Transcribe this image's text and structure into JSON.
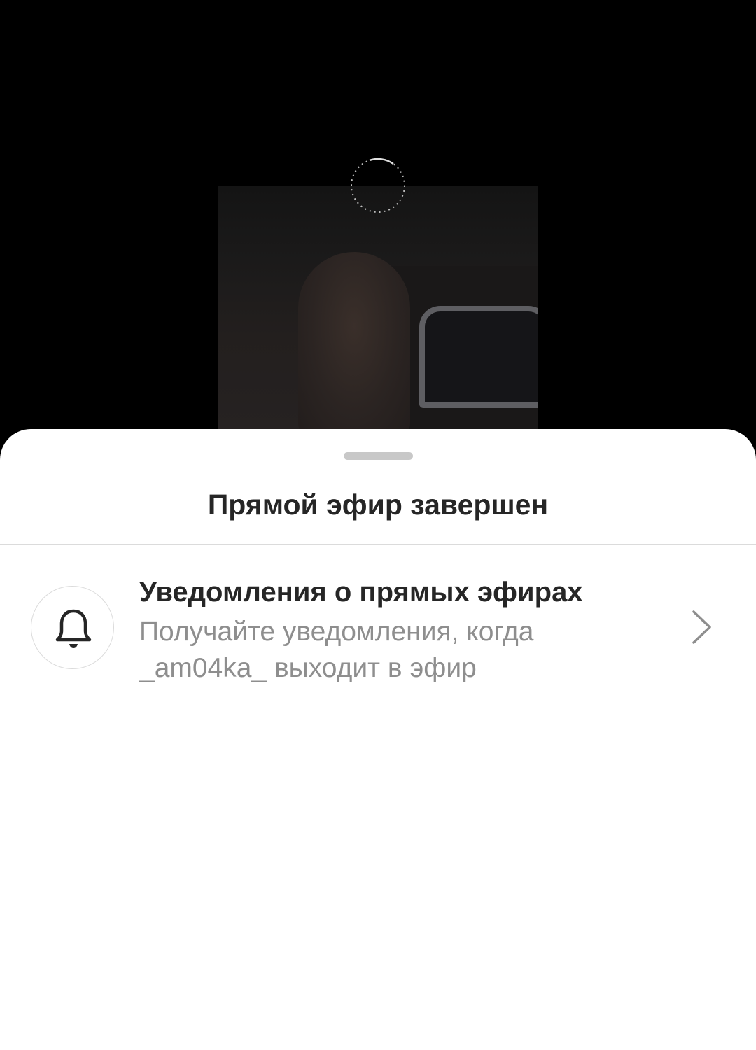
{
  "live_ended_sheet": {
    "title": "Прямой эфир завершен",
    "notifications_row": {
      "icon": "bell-icon",
      "title": "Уведомления о прямых эфирах",
      "subtitle": "Получайте уведомления, когда _am04ka_ выходит в эфир",
      "trailing_icon": "chevron-right-icon"
    }
  },
  "colors": {
    "background": "#000000",
    "sheet": "#ffffff",
    "title_text": "#262626",
    "secondary_text": "#8e8e8e",
    "divider": "#dbdbdb",
    "handle": "#c8c8c8"
  }
}
